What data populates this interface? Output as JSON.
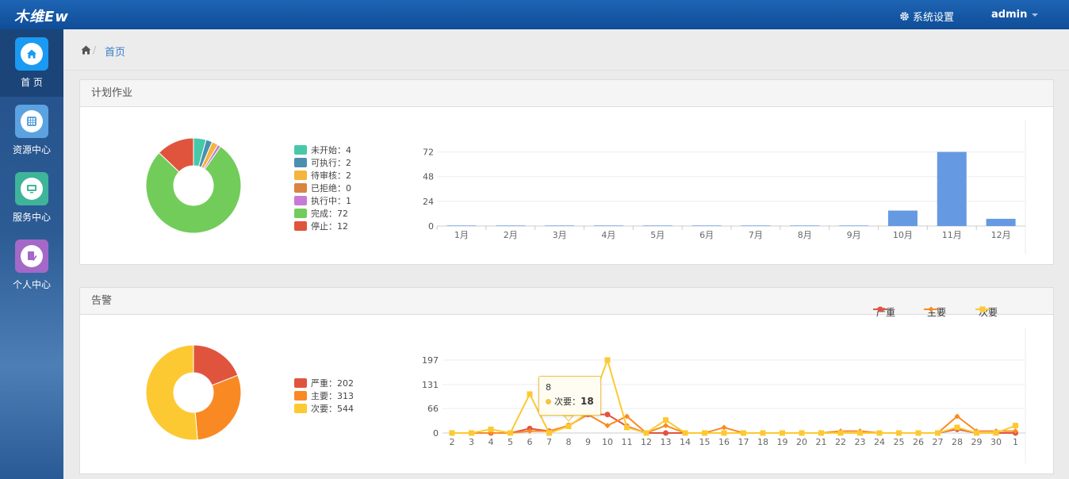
{
  "app": {
    "logo": "木维Ew"
  },
  "header": {
    "settings_label": "系统设置",
    "user": "admin"
  },
  "sidebar": {
    "items": [
      {
        "label": "首 页",
        "icon": "home-icon",
        "color": "#1a9af2",
        "active": true
      },
      {
        "label": "资源中心",
        "icon": "grid-icon",
        "color": "#5ba3e0",
        "active": false
      },
      {
        "label": "服务中心",
        "icon": "monitor-icon",
        "color": "#3fb49a",
        "active": false
      },
      {
        "label": "个人中心",
        "icon": "user-edit-icon",
        "color": "#a468c8",
        "active": false
      }
    ]
  },
  "breadcrumb": {
    "home_icon": "home-icon",
    "current": "首页"
  },
  "plan_panel": {
    "title": "计划作业",
    "legend": [
      {
        "label": "未开始：4",
        "color": "#47c9a9"
      },
      {
        "label": "可执行：2",
        "color": "#4a8fb0"
      },
      {
        "label": "待审核：2",
        "color": "#f5b43d"
      },
      {
        "label": "已拒绝：0",
        "color": "#d98440"
      },
      {
        "label": "执行中：1",
        "color": "#c77ad6"
      },
      {
        "label": "完成：72",
        "color": "#72cc5a"
      },
      {
        "label": "停止：12",
        "color": "#e0543e"
      }
    ]
  },
  "alert_panel": {
    "title": "告警",
    "legend": [
      {
        "label": "严重：202",
        "color": "#e0543e"
      },
      {
        "label": "主要：313",
        "color": "#f98a23"
      },
      {
        "label": "次要：544",
        "color": "#fcc932"
      }
    ],
    "tooltip": {
      "title": "8",
      "series": "次要：",
      "value": "18"
    }
  },
  "chart_data": [
    {
      "type": "pie",
      "categories": [
        "未开始",
        "可执行",
        "待审核",
        "已拒绝",
        "执行中",
        "完成",
        "停止"
      ],
      "values": [
        4,
        2,
        2,
        0,
        1,
        72,
        12
      ],
      "colors": [
        "#47c9a9",
        "#4a8fb0",
        "#f5b43d",
        "#d98440",
        "#c77ad6",
        "#72cc5a",
        "#e0543e"
      ]
    },
    {
      "type": "bar",
      "categories": [
        "1月",
        "2月",
        "3月",
        "4月",
        "5月",
        "6月",
        "7月",
        "8月",
        "9月",
        "10月",
        "11月",
        "12月"
      ],
      "values": [
        0.5,
        0.5,
        0.5,
        0.5,
        0.5,
        0.5,
        0.5,
        0.5,
        0.5,
        15,
        72,
        7
      ],
      "yticks": [
        0,
        24,
        48,
        72
      ],
      "ylim": [
        0,
        84
      ],
      "color": "#6599e2",
      "grid": true
    },
    {
      "type": "pie",
      "categories": [
        "严重",
        "主要",
        "次要"
      ],
      "values": [
        202,
        313,
        544
      ],
      "colors": [
        "#e0543e",
        "#f98a23",
        "#fcc932"
      ]
    },
    {
      "type": "line",
      "categories": [
        "2",
        "3",
        "4",
        "5",
        "6",
        "7",
        "8",
        "9",
        "10",
        "11",
        "12",
        "13",
        "14",
        "15",
        "16",
        "17",
        "18",
        "19",
        "20",
        "21",
        "22",
        "23",
        "24",
        "25",
        "26",
        "27",
        "28",
        "29",
        "30",
        "1"
      ],
      "yticks": [
        0,
        66,
        131,
        197
      ],
      "ylim": [
        0,
        197
      ],
      "legend_position": "top-right",
      "series": [
        {
          "name": "严重",
          "color": "#e0543e",
          "marker": "circle",
          "values": [
            0,
            0,
            0,
            0,
            12,
            5,
            20,
            50,
            50,
            18,
            0,
            0,
            0,
            0,
            0,
            0,
            0,
            0,
            0,
            0,
            0,
            0,
            0,
            0,
            0,
            0,
            10,
            0,
            0,
            0
          ]
        },
        {
          "name": "主要",
          "color": "#f98a23",
          "marker": "diamond",
          "values": [
            0,
            0,
            0,
            0,
            5,
            5,
            20,
            50,
            20,
            45,
            0,
            20,
            0,
            0,
            15,
            0,
            0,
            0,
            0,
            0,
            5,
            5,
            0,
            0,
            0,
            0,
            45,
            5,
            5,
            5
          ]
        },
        {
          "name": "次要",
          "color": "#fcc932",
          "marker": "square",
          "values": [
            0,
            0,
            10,
            0,
            105,
            0,
            18,
            55,
            197,
            15,
            0,
            35,
            0,
            0,
            0,
            0,
            0,
            0,
            0,
            0,
            0,
            0,
            0,
            0,
            0,
            0,
            15,
            0,
            0,
            20
          ]
        }
      ]
    }
  ]
}
